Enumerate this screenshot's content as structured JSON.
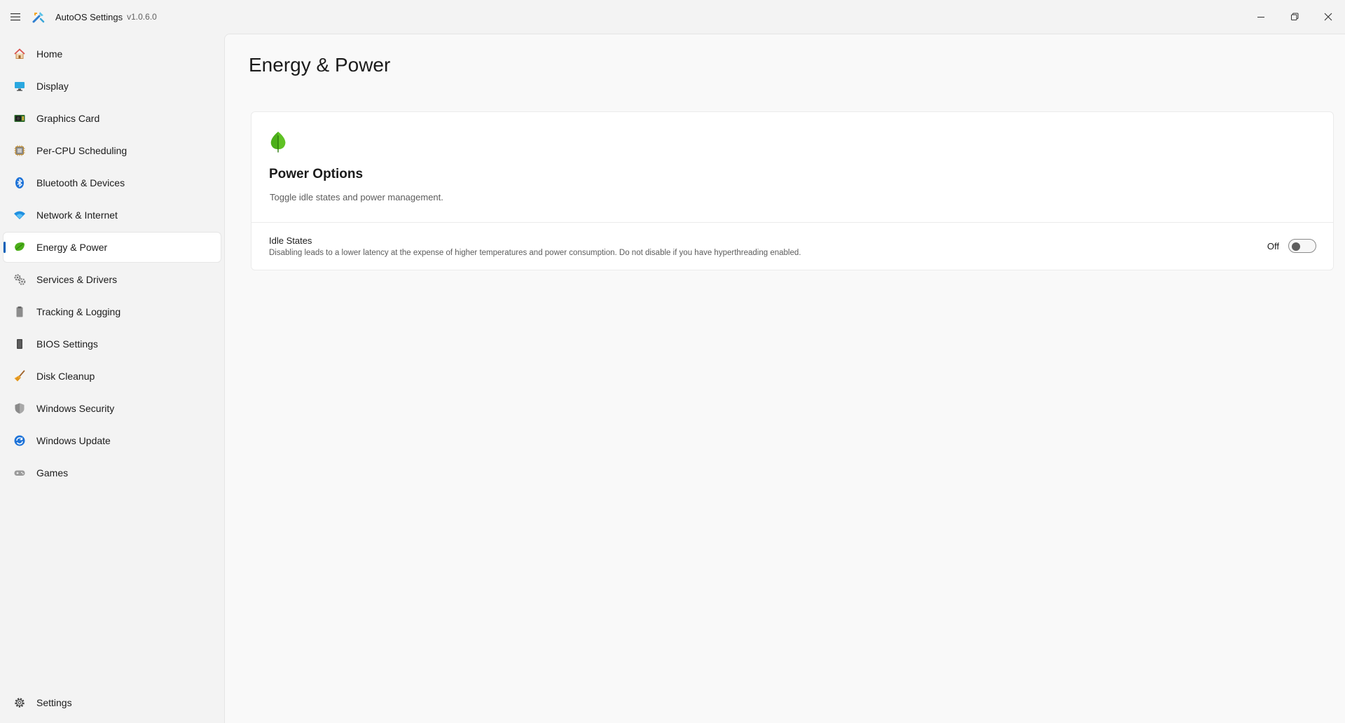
{
  "app": {
    "title": "AutoOS Settings",
    "version": "v1.0.6.0"
  },
  "window_controls": {
    "icons": [
      "minimize-icon",
      "restore-icon",
      "close-icon"
    ]
  },
  "sidebar": {
    "active": "Energy & Power",
    "items": [
      {
        "label": "Home",
        "icon": "home-icon"
      },
      {
        "label": "Display",
        "icon": "monitor-icon"
      },
      {
        "label": "Graphics Card",
        "icon": "gpu-icon"
      },
      {
        "label": "Per-CPU Scheduling",
        "icon": "cpu-icon"
      },
      {
        "label": "Bluetooth & Devices",
        "icon": "bluetooth-icon"
      },
      {
        "label": "Network & Internet",
        "icon": "wifi-icon"
      },
      {
        "label": "Energy & Power",
        "icon": "leaf-icon"
      },
      {
        "label": "Services & Drivers",
        "icon": "gears-icon"
      },
      {
        "label": "Tracking & Logging",
        "icon": "clipboard-icon"
      },
      {
        "label": "BIOS Settings",
        "icon": "chip-icon"
      },
      {
        "label": "Disk Cleanup",
        "icon": "broom-icon"
      },
      {
        "label": "Windows Security",
        "icon": "shield-icon"
      },
      {
        "label": "Windows Update",
        "icon": "update-icon"
      },
      {
        "label": "Games",
        "icon": "gamepad-icon"
      }
    ],
    "footer": {
      "label": "Settings",
      "icon": "gear-icon"
    }
  },
  "main": {
    "title": "Energy & Power",
    "card": {
      "title": "Power Options",
      "description": "Toggle idle states and power management.",
      "rows": [
        {
          "title": "Idle States",
          "description": "Disabling leads to a lower latency at the expense of higher temperatures and power consumption. Do not disable if you have hyperthreading enabled.",
          "state_label": "Off",
          "toggle_on": false
        }
      ]
    }
  },
  "colors": {
    "accent": "#005fb8",
    "leaf_green": "#4caf1a",
    "window_bg": "#f3f3f3",
    "content_bg": "#f9f9f9"
  }
}
